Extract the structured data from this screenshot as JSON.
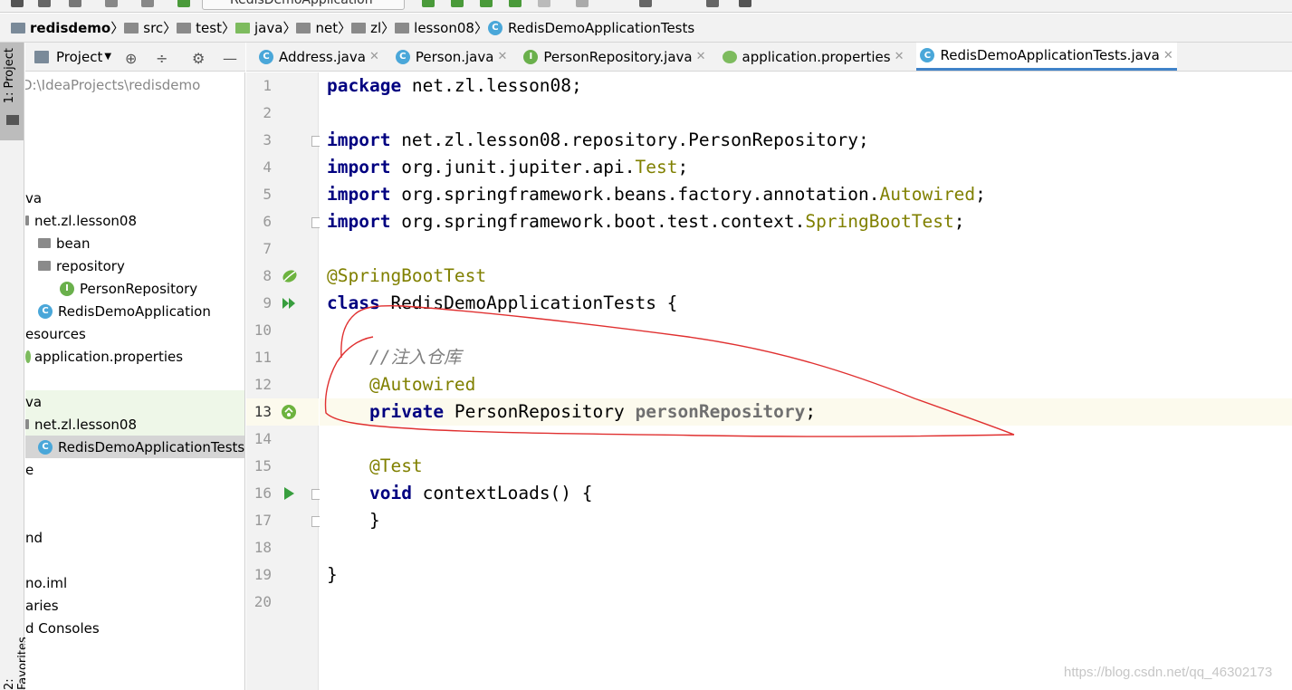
{
  "toolbar": {
    "run_config": "RedisDemoApplication"
  },
  "breadcrumb": {
    "items": [
      "redisdemo",
      "src",
      "test",
      "java",
      "net",
      "zl",
      "lesson08",
      "RedisDemoApplicationTests"
    ]
  },
  "side_strip": {
    "project_tab": "1: Project",
    "favorites_tab": "2: Favorites"
  },
  "project_panel": {
    "selector_label": "Project",
    "tree": [
      {
        "label": "D:\\IdeaProjects\\redisdemo"
      },
      {
        "label": "va"
      },
      {
        "label": "net.zl.lesson08"
      },
      {
        "label": "bean"
      },
      {
        "label": "repository"
      },
      {
        "label": "PersonRepository"
      },
      {
        "label": "RedisDemoApplication"
      },
      {
        "label": "esources"
      },
      {
        "label": "application.properties"
      },
      {
        "label": "va"
      },
      {
        "label": "net.zl.lesson08"
      },
      {
        "label": "RedisDemoApplicationTests"
      },
      {
        "label": "e"
      },
      {
        "label": "nd"
      },
      {
        "label": "no.iml"
      },
      {
        "label": "aries"
      },
      {
        "label": "d Consoles"
      }
    ]
  },
  "editor": {
    "tabs": [
      {
        "label": "Address.java",
        "icon": "class-icon"
      },
      {
        "label": "Person.java",
        "icon": "class-icon"
      },
      {
        "label": "PersonRepository.java",
        "icon": "interface-icon"
      },
      {
        "label": "application.properties",
        "icon": "properties-icon"
      },
      {
        "label": "RedisDemoApplicationTests.java",
        "icon": "class-icon",
        "active": true
      }
    ],
    "line_numbers": [
      "1",
      "2",
      "3",
      "4",
      "5",
      "6",
      "7",
      "8",
      "9",
      "10",
      "11",
      "12",
      "13",
      "14",
      "15",
      "16",
      "17",
      "18",
      "19",
      "20"
    ],
    "code": {
      "l1_kw": "package",
      "l1_rest": " net.zl.lesson08;",
      "l3_kw": "import",
      "l3_rest": " net.zl.lesson08.repository.PersonRepository;",
      "l4_kw": "import",
      "l4_rest": " org.junit.jupiter.api.",
      "l4_ann": "Test",
      "l4_end": ";",
      "l5_kw": "import",
      "l5_rest": " org.springframework.beans.factory.annotation.",
      "l5_ann": "Autowired",
      "l5_end": ";",
      "l6_kw": "import",
      "l6_rest": " org.springframework.boot.test.context.",
      "l6_ann": "SpringBootTest",
      "l6_end": ";",
      "l8_ann": "@SpringBootTest",
      "l9_kw": "class",
      "l9_rest": " RedisDemoApplicationTests {",
      "l11_cmt": "//注入仓库",
      "l12_ann": "@Autowired",
      "l13_kw": "private",
      "l13_type": " PersonRepository ",
      "l13_field": "personRepository",
      "l13_end": ";",
      "l15_ann": "@Test",
      "l16_kw": "void",
      "l16_rest": " contextLoads() {",
      "l17": "}",
      "l19": "}"
    }
  },
  "watermark": "https://blog.csdn.net/qq_46302173",
  "colors": {
    "keyword": "#000080",
    "annotation": "#808000",
    "comment": "#808080",
    "scribble": "#e03030",
    "active_tab_underline": "#4083c9"
  }
}
